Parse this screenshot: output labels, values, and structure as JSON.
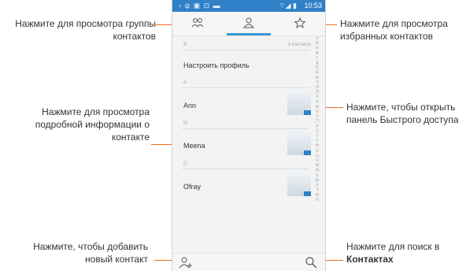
{
  "status": {
    "left": "▫ ψ ▣ ⊡ ▬",
    "signal": "⌔◢ ▮",
    "time": "10:53"
  },
  "list": {
    "section_me": "Я",
    "section_me_count": "3 контакта",
    "profile": "Настроить профиль",
    "contacts": [
      {
        "section": "A",
        "name": "Ann"
      },
      {
        "section": "M",
        "name": "Meena"
      },
      {
        "section": "O",
        "name": "Ofray"
      }
    ]
  },
  "alphabet": [
    "#",
    "А",
    "Б",
    "В",
    "Г",
    "Д",
    "Е",
    "Ё",
    "Ж",
    "З",
    "И",
    "Й",
    "К",
    "Л",
    "М",
    "Н",
    "О",
    "П",
    "Р",
    "С",
    "Т",
    "У",
    "Ф",
    "Х",
    "Ц",
    "Ч",
    "Ш",
    "Щ",
    "Ъ",
    "Ы",
    "Ь",
    "Э",
    "Ю",
    "Я"
  ],
  "callouts": {
    "groups": "Нажмите для просмотра группы контактов",
    "favorites": "Нажмите для просмотра избранных контактов",
    "details": "Нажмите для просмотра подробной информации о контакте",
    "quick_panel": "Нажмите, чтобы открыть панель Быстрого доступа",
    "add": "Нажмите, чтобы добавить новый контакт",
    "search_prefix": "Нажмите для поиск в",
    "search_bold": "Контактах"
  },
  "colors": {
    "accent": "#3b9ad8",
    "status_bar": "#2f80c6",
    "pointer": "#f06a1e"
  }
}
